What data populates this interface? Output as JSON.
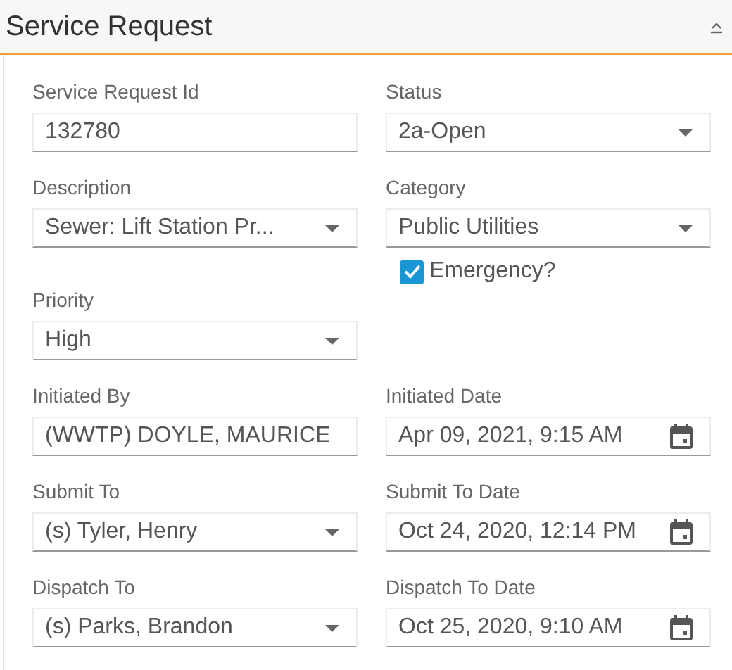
{
  "panel": {
    "title": "Service Request"
  },
  "fields": [
    {
      "label": "Service Request Id",
      "kind": "text",
      "value": "132780"
    },
    {
      "label": "Status",
      "kind": "select",
      "value": "2a-Open"
    },
    {
      "label": "Description",
      "kind": "select",
      "value": "Sewer: Lift Station Pr..."
    },
    {
      "label": "Category",
      "kind": "select",
      "value": "Public Utilities",
      "checkbox": {
        "label": "Emergency?",
        "checked": true
      }
    },
    {
      "label": "Priority",
      "kind": "select",
      "value": "High"
    },
    {
      "kind": "empty"
    },
    {
      "label": "Initiated By",
      "kind": "text",
      "value": "(WWTP) DOYLE, MAURICE"
    },
    {
      "label": "Initiated Date",
      "kind": "date",
      "value": "Apr 09, 2021, 9:15 AM"
    },
    {
      "label": "Submit To",
      "kind": "select",
      "value": "(s) Tyler, Henry"
    },
    {
      "label": "Submit To Date",
      "kind": "date",
      "value": "Oct 24, 2020, 12:14 PM"
    },
    {
      "label": "Dispatch To",
      "kind": "select",
      "value": "(s) Parks, Brandon"
    },
    {
      "label": "Dispatch To Date",
      "kind": "date",
      "value": "Oct 25, 2020, 9:10 AM"
    }
  ]
}
